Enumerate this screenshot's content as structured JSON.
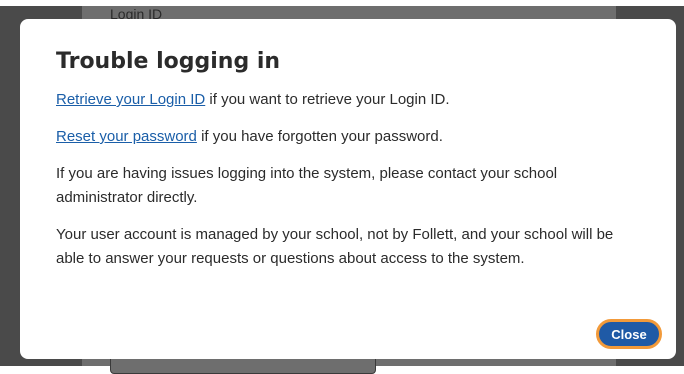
{
  "background": {
    "field_label": "Login ID"
  },
  "modal": {
    "title": "Trouble logging in",
    "retrieve_link": "Retrieve your Login ID",
    "retrieve_text": " if you want to retrieve your Login ID.",
    "reset_link": "Reset your password",
    "reset_text": " if you have forgotten your password.",
    "issues_text": "If you are having issues logging into the system, please contact your school administrator directly.",
    "account_text": "Your user account is managed by your school, not by Follett, and your school will be able to answer your requests or questions about access to the system.",
    "close_label": "Close"
  },
  "colors": {
    "accent": "#1f5aa6",
    "link": "#1a5ea8",
    "focus_ring": "#f29a3a",
    "overlay": "#4a4a4a"
  }
}
